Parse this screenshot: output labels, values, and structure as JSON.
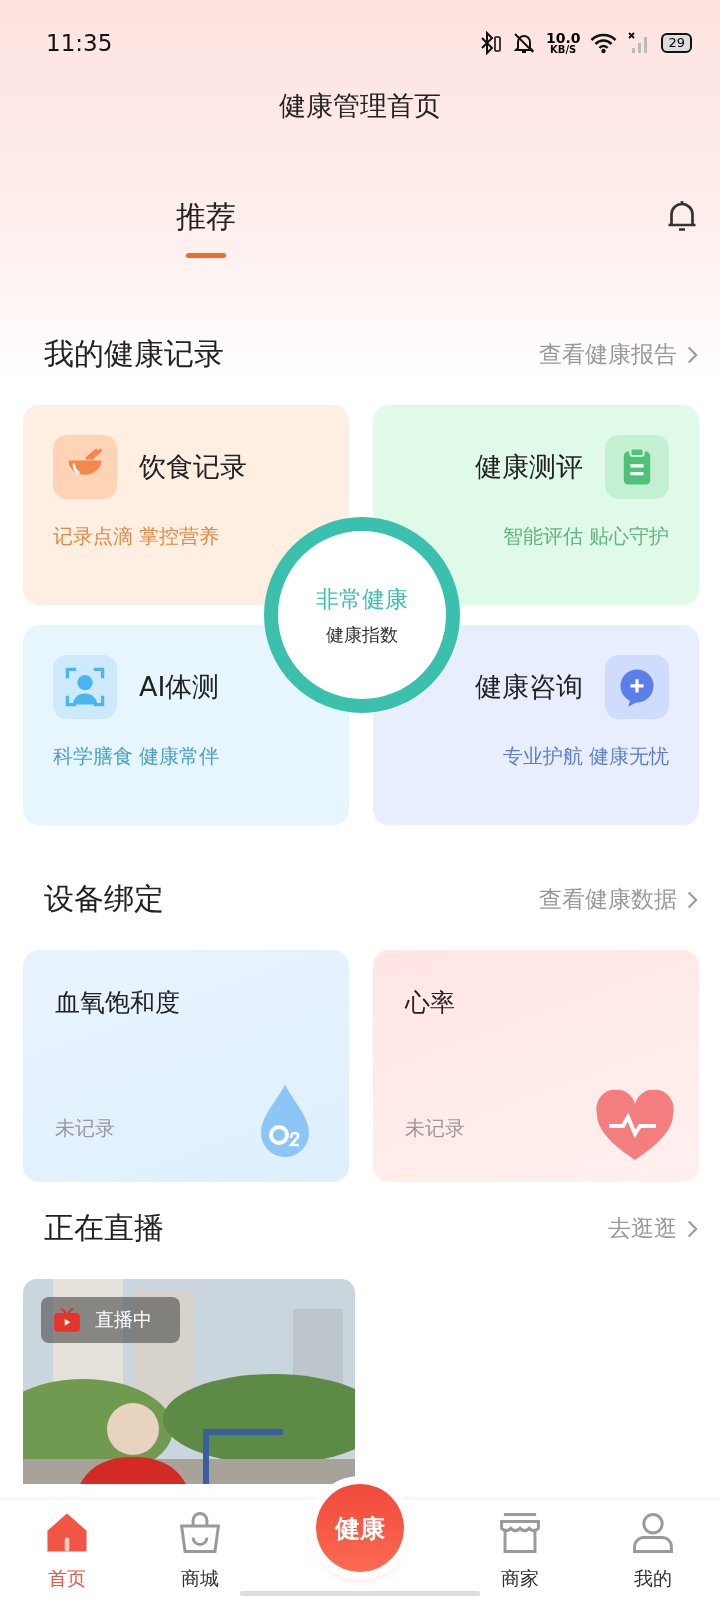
{
  "status_bar": {
    "time": "11:35",
    "speed_value": "10.0",
    "speed_unit": "KB/S",
    "battery": "29"
  },
  "header": {
    "title": "健康管理首页"
  },
  "tabs": [
    {
      "label": "推荐",
      "selected": true
    }
  ],
  "health_records": {
    "title": "我的健康记录",
    "link": "查看健康报告",
    "cards": [
      {
        "kind": "diet",
        "title": "饮食记录",
        "subtitle": "记录点滴 掌控营养"
      },
      {
        "kind": "assessment",
        "title": "健康测评",
        "subtitle": "智能评估 贴心守护"
      },
      {
        "kind": "ai",
        "title": "AI体测",
        "subtitle": "科学膳食 健康常伴"
      },
      {
        "kind": "consult",
        "title": "健康咨询",
        "subtitle": "专业护航 健康无忧"
      }
    ],
    "index": {
      "value": "非常健康",
      "label": "健康指数"
    }
  },
  "devices": {
    "title": "设备绑定",
    "link": "查看健康数据",
    "cards": [
      {
        "kind": "oxygen",
        "title": "血氧饱和度",
        "status": "未记录"
      },
      {
        "kind": "heart",
        "title": "心率",
        "status": "未记录"
      }
    ]
  },
  "live": {
    "title": "正在直播",
    "link": "去逛逛",
    "items": [
      {
        "kind": "picture",
        "badge": "直播中"
      }
    ]
  },
  "bottom_nav": [
    {
      "kind": "home",
      "label": "首页",
      "selected": true
    },
    {
      "kind": "shop",
      "label": "商城",
      "selected": false
    },
    {
      "kind": "center",
      "label": "健康",
      "selected": false
    },
    {
      "kind": "store",
      "label": "商家",
      "selected": false
    },
    {
      "kind": "user",
      "label": "我的",
      "selected": false
    }
  ]
}
